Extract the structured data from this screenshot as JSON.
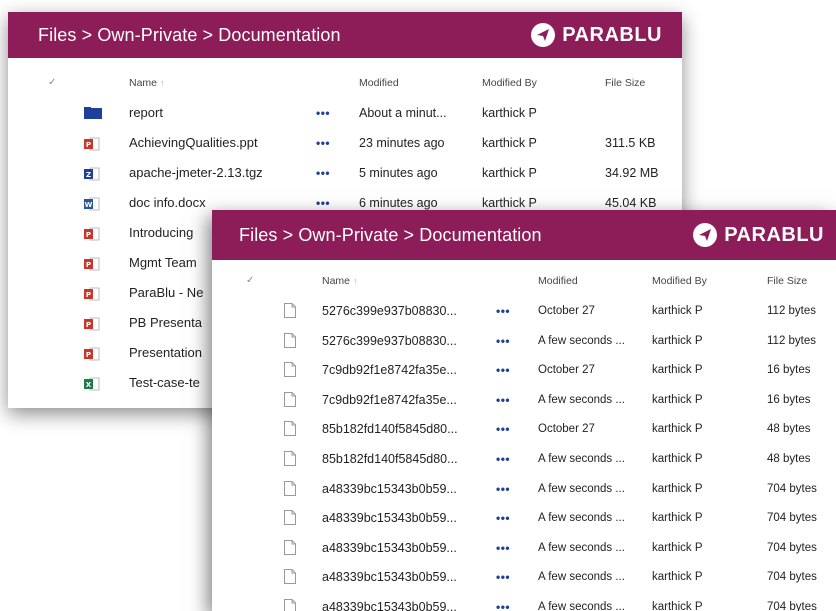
{
  "back_window": {
    "breadcrumb": "Files > Own-Private > Documentation",
    "brand": "PARABLU",
    "columns": {
      "name": "Name",
      "sort": "↑",
      "modified": "Modified",
      "modified_by": "Modified By",
      "file_size": "File Size"
    },
    "rows": [
      {
        "icon": "folder-icon",
        "name": "report",
        "modified": "About a minut...",
        "by": "karthick P",
        "size": ""
      },
      {
        "icon": "powerpoint-file-icon",
        "name": "AchievingQualities.ppt",
        "modified": "23 minutes ago",
        "by": "karthick P",
        "size": "311.5 KB"
      },
      {
        "icon": "archive-file-icon",
        "name": "apache-jmeter-2.13.tgz",
        "modified": "5 minutes ago",
        "by": "karthick P",
        "size": "34.92 MB"
      },
      {
        "icon": "word-file-icon",
        "name": "doc info.docx",
        "modified": "6 minutes ago",
        "by": "karthick P",
        "size": "45.04 KB"
      },
      {
        "icon": "powerpoint-file-icon",
        "name": "Introducing",
        "modified": "",
        "by": "",
        "size": ""
      },
      {
        "icon": "powerpoint-file-icon",
        "name": "Mgmt Team",
        "modified": "",
        "by": "",
        "size": ""
      },
      {
        "icon": "powerpoint-file-icon",
        "name": "ParaBlu - Ne",
        "modified": "",
        "by": "",
        "size": ""
      },
      {
        "icon": "powerpoint-file-icon",
        "name": "PB Presenta",
        "modified": "",
        "by": "",
        "size": ""
      },
      {
        "icon": "powerpoint-file-icon",
        "name": "Presentation",
        "modified": "",
        "by": "",
        "size": ""
      },
      {
        "icon": "excel-file-icon",
        "name": "Test-case-te",
        "modified": "",
        "by": "",
        "size": ""
      }
    ]
  },
  "front_window": {
    "breadcrumb": "Files > Own-Private > Documentation",
    "brand": "PARABLU",
    "columns": {
      "name": "Name",
      "sort": "↑",
      "modified": "Modified",
      "modified_by": "Modified By",
      "file_size": "File Size"
    },
    "rows": [
      {
        "name": "5276c399e937b08830...",
        "modified": "October 27",
        "by": "karthick P",
        "size": "112 bytes"
      },
      {
        "name": "5276c399e937b08830...",
        "modified": "A few seconds ...",
        "by": "karthick P",
        "size": "112 bytes"
      },
      {
        "name": "7c9db92f1e8742fa35e...",
        "modified": "October 27",
        "by": "karthick P",
        "size": "16 bytes"
      },
      {
        "name": "7c9db92f1e8742fa35e...",
        "modified": "A few seconds ...",
        "by": "karthick P",
        "size": "16 bytes"
      },
      {
        "name": "85b182fd140f5845d80...",
        "modified": "October 27",
        "by": "karthick P",
        "size": "48 bytes"
      },
      {
        "name": "85b182fd140f5845d80...",
        "modified": "A few seconds ...",
        "by": "karthick P",
        "size": "48 bytes"
      },
      {
        "name": "a48339bc15343b0b59...",
        "modified": "A few seconds ...",
        "by": "karthick P",
        "size": "704 bytes"
      },
      {
        "name": "a48339bc15343b0b59...",
        "modified": "A few seconds ...",
        "by": "karthick P",
        "size": "704 bytes"
      },
      {
        "name": "a48339bc15343b0b59...",
        "modified": "A few seconds ...",
        "by": "karthick P",
        "size": "704 bytes"
      },
      {
        "name": "a48339bc15343b0b59...",
        "modified": "A few seconds ...",
        "by": "karthick P",
        "size": "704 bytes"
      },
      {
        "name": "a48339bc15343b0b59...",
        "modified": "A few seconds ...",
        "by": "karthick P",
        "size": "704 bytes"
      }
    ]
  },
  "more_label": "•••",
  "check_label": "✓",
  "colors": {
    "header": "#8c1d58",
    "dots": "#1e3f96",
    "ppt": "#c8372d",
    "word": "#2b5797",
    "excel": "#1f7a45",
    "folder": "#1f3f9c"
  }
}
